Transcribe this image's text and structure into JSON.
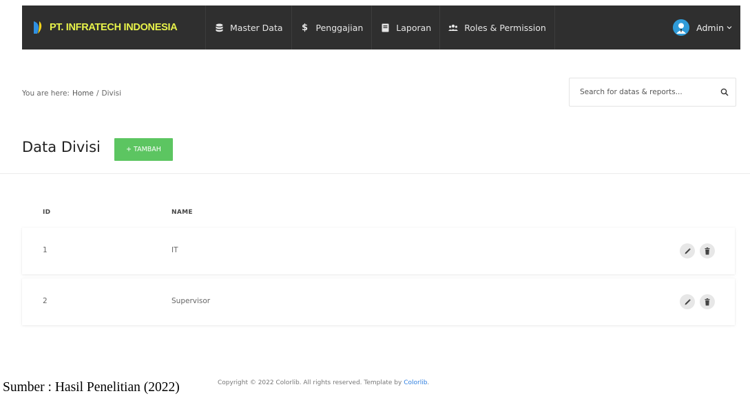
{
  "brand": {
    "name": "PT. INFRATECH INDONESIA",
    "logo_colors": [
      "#2f8fe0",
      "#f2d21a"
    ]
  },
  "nav": {
    "items": [
      {
        "label": "Master Data",
        "icon": "database-icon"
      },
      {
        "label": "Penggajian",
        "icon": "dollar-icon"
      },
      {
        "label": "Laporan",
        "icon": "book-icon"
      },
      {
        "label": "Roles & Permission",
        "icon": "users-icon"
      }
    ],
    "user": {
      "name": "Admin",
      "icon": "user-avatar-icon"
    }
  },
  "breadcrumb": {
    "prefix": "You are here:",
    "items": [
      "Home",
      "Divisi"
    ],
    "separator": "/"
  },
  "search": {
    "placeholder": "Search for datas & reports...",
    "value": ""
  },
  "page": {
    "title": "Data Divisi",
    "add_label": "+ TAMBAH"
  },
  "table": {
    "columns": [
      "ID",
      "NAME"
    ],
    "rows": [
      {
        "id": "1",
        "name": "IT"
      },
      {
        "id": "2",
        "name": "Supervisor"
      }
    ]
  },
  "footer": {
    "caption": "Sumber : Hasil Penelitian (2022)",
    "copyright_text": "Copyright © 2022 Colorlib. All rights reserved. Template by ",
    "copyright_link": "Colorlib",
    "copyright_end": "."
  },
  "colors": {
    "navbar": "#2f2f2f",
    "brand_text": "#e8f34a",
    "accent_green": "#5cc561",
    "link": "#2f7fe0"
  }
}
